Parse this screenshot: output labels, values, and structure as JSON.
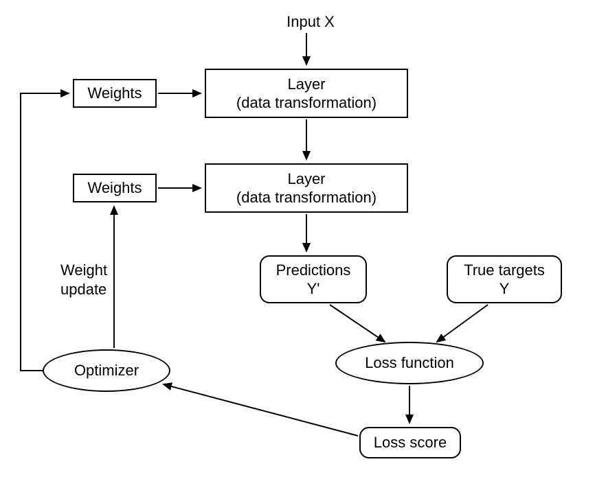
{
  "diagram": {
    "input_label": "Input X",
    "weights1": "Weights",
    "weights2": "Weights",
    "layer1_line1": "Layer",
    "layer1_line2": "(data transformation)",
    "layer2_line1": "Layer",
    "layer2_line2": "(data transformation)",
    "predictions_line1": "Predictions",
    "predictions_line2": "Y'",
    "true_targets_line1": "True targets",
    "true_targets_line2": "Y",
    "loss_function": "Loss function",
    "loss_score": "Loss score",
    "optimizer": "Optimizer",
    "weight_update_line1": "Weight",
    "weight_update_line2": "update"
  }
}
